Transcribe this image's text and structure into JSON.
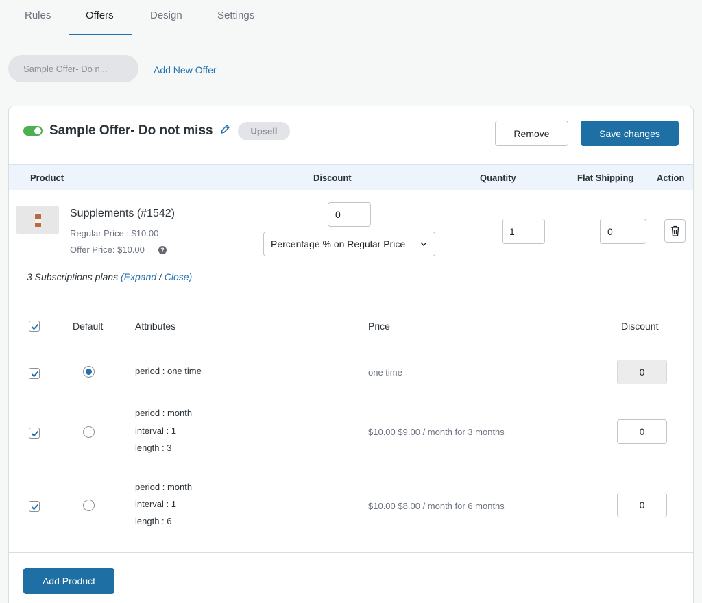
{
  "tabs": [
    {
      "label": "Rules"
    },
    {
      "label": "Offers"
    },
    {
      "label": "Design"
    },
    {
      "label": "Settings"
    }
  ],
  "offers_bar": {
    "offer_pill": "Sample Offer- Do n...",
    "add_new_offer": "Add New Offer"
  },
  "offer": {
    "enabled": true,
    "title": "Sample Offer- Do not miss",
    "type_badge": "Upsell",
    "remove_label": "Remove",
    "save_label": "Save changes",
    "accent_color": "#1d6fa4",
    "toggle_color": "#4caf50"
  },
  "table": {
    "headers": {
      "product": "Product",
      "discount": "Discount",
      "quantity": "Quantity",
      "flat_shipping": "Flat Shipping",
      "action": "Action"
    }
  },
  "product": {
    "name": "Supplements (#1542)",
    "regular_price": "Regular Price : $10.00",
    "offer_price": "Offer Price: $10.00",
    "help_glyph": "?",
    "discount_value": "0",
    "discount_type": "Percentage % on Regular Price",
    "quantity": "1",
    "flat_shipping": "0",
    "action_icon": "trash-icon"
  },
  "subscriptions": {
    "summary_prefix": "3 Subscriptions plans",
    "open_paren": "(",
    "expand_label": "Expand",
    "slash": "/",
    "close_label": "Close)",
    "headers": {
      "default": "Default",
      "attributes": "Attributes",
      "price": "Price",
      "discount": "Discount"
    },
    "plans": [
      {
        "checked": true,
        "default": true,
        "attributes": [
          "period : one time"
        ],
        "price_text": "one time",
        "discount": "0"
      },
      {
        "checked": true,
        "default": false,
        "attributes": [
          "period : month",
          "interval : 1",
          "length : 3"
        ],
        "price_old": "$10.00",
        "price_new": "$9.00",
        "price_suffix": "/ month for 3 months",
        "discount": "0"
      },
      {
        "checked": true,
        "default": false,
        "attributes": [
          "period : month",
          "interval : 1",
          "length : 6"
        ],
        "price_old": "$10.00",
        "price_new": "$8.00",
        "price_suffix": "/ month for 6 months",
        "discount": "0"
      }
    ]
  },
  "footer": {
    "add_product_label": "Add Product"
  }
}
